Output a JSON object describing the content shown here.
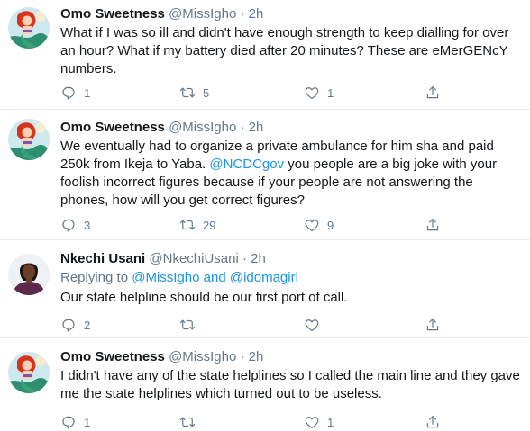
{
  "tweets": [
    {
      "name": "Omo Sweetness",
      "handle": "@MissIgho",
      "dot": "·",
      "time": "2h",
      "avatar_icon": "mermaid-avatar",
      "text": "What if I was so ill and didn't have enough strength to keep dialling for over an hour? What if my battery died after 20 minutes? These are eMerGENcY numbers.",
      "replies": "1",
      "retweets": "5",
      "likes": "1"
    },
    {
      "name": "Omo Sweetness",
      "handle": "@MissIgho",
      "dot": "·",
      "time": "2h",
      "avatar_icon": "mermaid-avatar",
      "text_before": "We eventually had to organize a private ambulance for him sha and paid 250k from Ikeja to Yaba. ",
      "mention": "@NCDCgov",
      "text_after": " you people are a big joke with your foolish incorrect figures because if your people are not answering the phones, how will you get correct figures?",
      "replies": "3",
      "retweets": "29",
      "likes": "9"
    },
    {
      "name": "Nkechi Usani",
      "handle": "@NkechiUsani",
      "dot": "·",
      "time": "2h",
      "avatar_icon": "woman-avatar",
      "reply_prefix": "Replying to ",
      "reply_user1": "@MissIgho",
      "reply_and": " and ",
      "reply_user2": "@idomagirl",
      "text": "Our state helpline should be our first port of call.",
      "replies": "2",
      "retweets": "",
      "likes": ""
    },
    {
      "name": "Omo Sweetness",
      "handle": "@MissIgho",
      "dot": "·",
      "time": "2h",
      "avatar_icon": "mermaid-avatar",
      "text": "I didn't have any of the state helplines so I called the main line and they gave me the state helplines which turned out to be useless.",
      "replies": "1",
      "retweets": "",
      "likes": "1"
    }
  ],
  "colors": {
    "accent": "#1b95e0",
    "muted": "#657786",
    "text": "#14171a",
    "border": "#e6ecf0"
  }
}
